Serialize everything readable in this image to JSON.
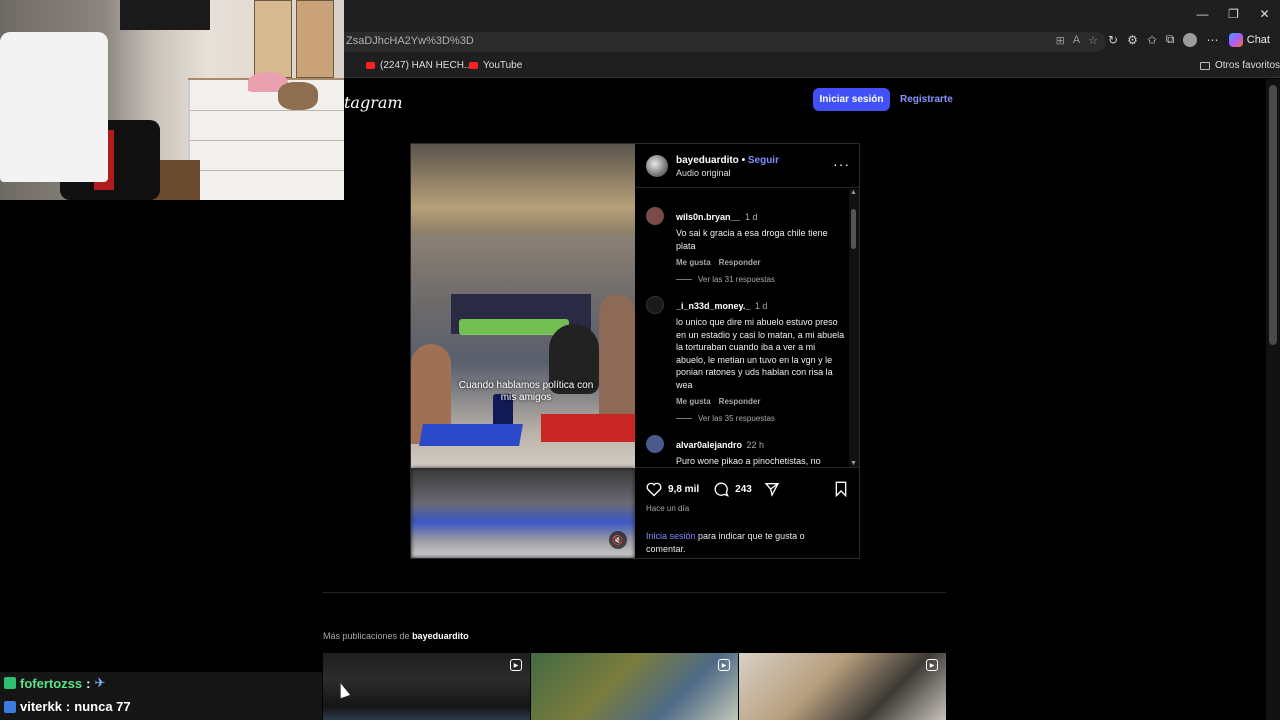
{
  "browser": {
    "url": "ZsaDJhcHA2Yw%3D%3D",
    "chat_label": "Chat",
    "bookmarks": [
      {
        "label": "(2247) HAN HECH...",
        "icon": "youtube-icon"
      },
      {
        "label": "YouTube",
        "icon": "youtube-icon"
      }
    ],
    "other_favorites": "Otros favoritos"
  },
  "instagram": {
    "logo": "tagram",
    "login_button": "Iniciar sesión",
    "signup_link": "Registrarte"
  },
  "post": {
    "author": "bayeduardito",
    "separator": " • ",
    "follow": "Seguir",
    "audio": "Audio original",
    "video_caption": "Cuando hablamos política con mis amigos",
    "comments": [
      {
        "user": "wils0n.bryan__",
        "time": "1 d",
        "text": "Vo sai k gracia a esa droga chile tiene plata",
        "like": "Me gusta",
        "reply": "Responder",
        "replies": "Ver las 31 respuestas"
      },
      {
        "user": "_i_n33d_money._",
        "time": "1 d",
        "text": "lo unico que dire mi abuelo estuvo preso en un estadio y casi lo matan, a mi abuela la torturaban cuando iba a ver a mi abuelo, le metian un tuvo en la vgn y le ponian ratones y uds hablan con risa la wea",
        "like": "Me gusta",
        "reply": "Responder",
        "replies": "Ver las 35 respuestas"
      },
      {
        "user": "alvar0alejandro",
        "time": "22 h",
        "text": "Puro wone pikao a pinochetistas, no saben de la vida, cuando agarren una"
      }
    ],
    "likes": "9,8 mil",
    "comment_count": "243",
    "time_ago": "Hace un día",
    "login_hint_link": "Inicia sesión",
    "login_hint_rest": " para indicar que te gusta o comentar."
  },
  "more_posts": {
    "prefix": "Más publicaciones de ",
    "author": "bayeduardito"
  },
  "stream_chat": [
    {
      "user": "fofertozss",
      "sep": " :",
      "message": ""
    },
    {
      "user": "viterkk",
      "sep": " :",
      "message": "nunca 77"
    }
  ],
  "colors": {
    "accent": "#4150f7",
    "link": "#7f8cff",
    "chat_green": "#5fe08a"
  }
}
